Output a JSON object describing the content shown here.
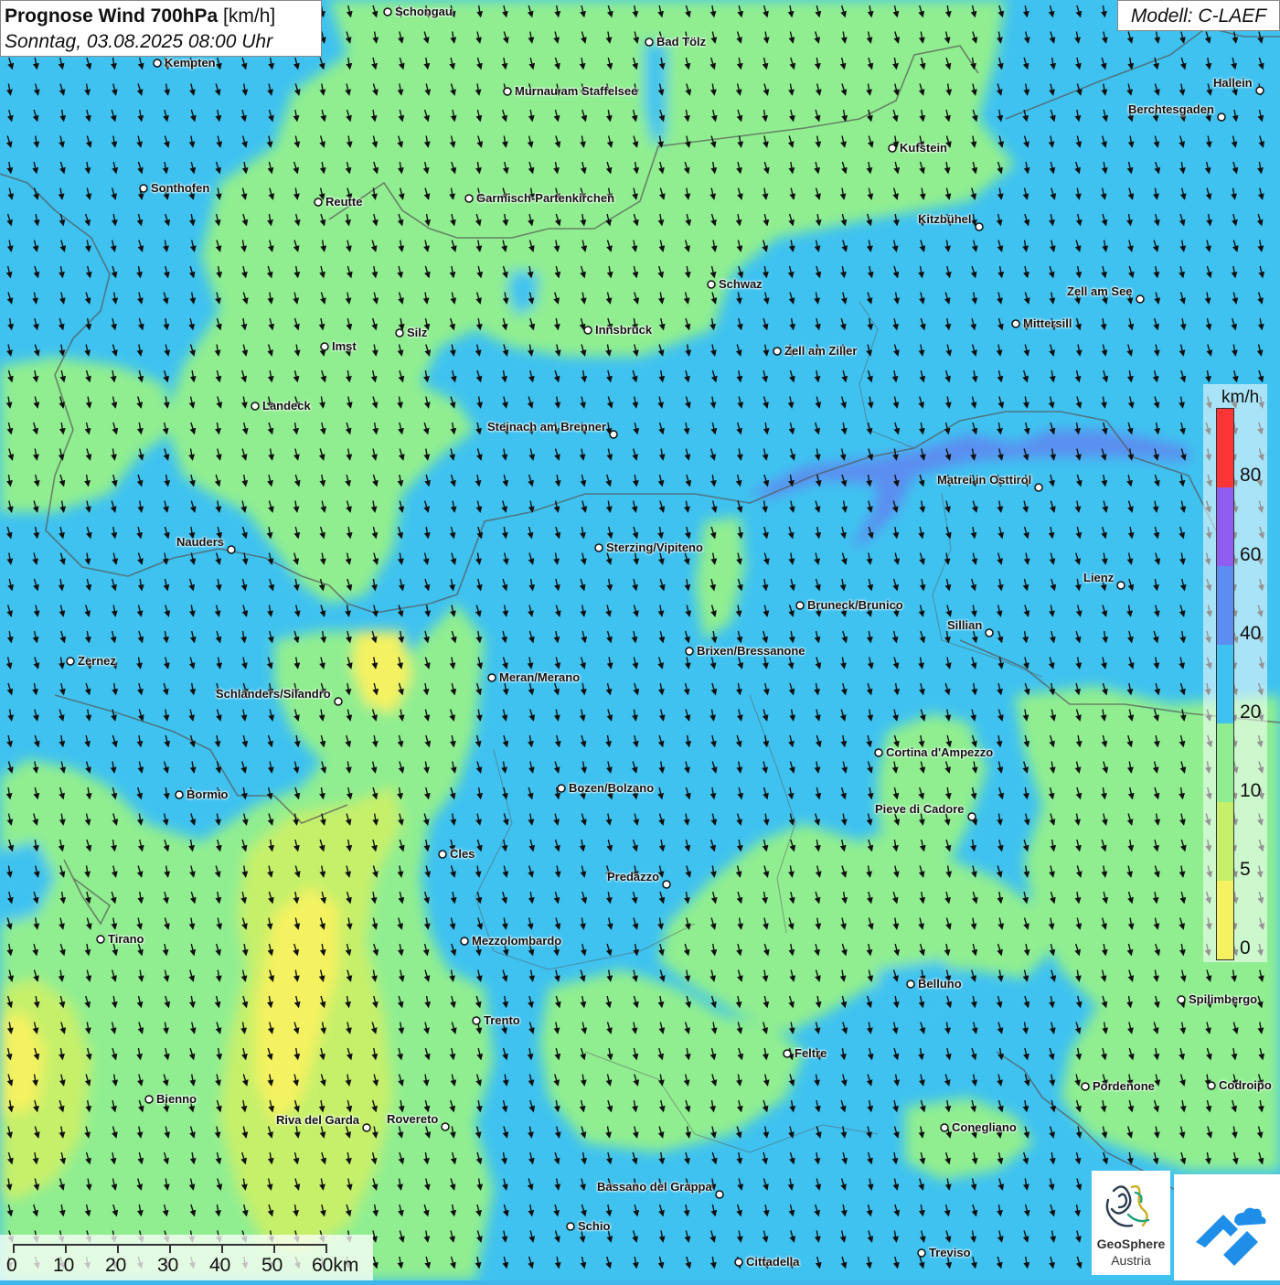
{
  "header": {
    "title_bold": "Prognose Wind 700hPa",
    "title_unit": "[km/h]",
    "subtitle": "Sonntag, 03.08.2025 08:00 Uhr",
    "model": "Modell: C-LAEF"
  },
  "legend": {
    "unit": "km/h",
    "labels": [
      "80",
      "60",
      "40",
      "20",
      "10",
      "5",
      "0"
    ],
    "colors": {
      "c0_5": "#f4f260",
      "c5_10": "#c6f06a",
      "c10_20": "#90ee90",
      "c20_40": "#3fc2f0",
      "c40_60": "#5b8ef0",
      "c60_80": "#8f5df0",
      "c80_plus": "#ff3535"
    }
  },
  "cities": [
    {
      "name": "Schongau"
    },
    {
      "name": "Bad Tölz"
    },
    {
      "name": "Kempten"
    },
    {
      "name": "Murnau am Staffelsee"
    },
    {
      "name": "Hallein"
    },
    {
      "name": "Berchtesgaden"
    },
    {
      "name": "Kufstein"
    },
    {
      "name": "Sonthofen"
    },
    {
      "name": "Reutte"
    },
    {
      "name": "Garmisch-Partenkirchen"
    },
    {
      "name": "Kitzbühel"
    },
    {
      "name": "Schwaz"
    },
    {
      "name": "Zell am See"
    },
    {
      "name": "Mittersill"
    },
    {
      "name": "Innsbruck"
    },
    {
      "name": "Silz"
    },
    {
      "name": "Imst"
    },
    {
      "name": "Zell am Ziller"
    },
    {
      "name": "Landeck"
    },
    {
      "name": "Steinach am Brenner"
    },
    {
      "name": "Matrei in Osttirol"
    },
    {
      "name": "Nauders"
    },
    {
      "name": "Sterzing/Vipiteno"
    },
    {
      "name": "Lienz"
    },
    {
      "name": "Bruneck/Brunico"
    },
    {
      "name": "Sillian"
    },
    {
      "name": "Brixen/Bressanone"
    },
    {
      "name": "Zernez"
    },
    {
      "name": "Meran/Merano"
    },
    {
      "name": "Schlanders/Silandro"
    },
    {
      "name": "Cortina d'Ampezzo"
    },
    {
      "name": "Bozen/Bolzano"
    },
    {
      "name": "Bormio"
    },
    {
      "name": "Pieve di Cadore"
    },
    {
      "name": "Cles"
    },
    {
      "name": "Predazzo"
    },
    {
      "name": "Tirano"
    },
    {
      "name": "Mezzolombardo"
    },
    {
      "name": "Belluno"
    },
    {
      "name": "Spilimbergo"
    },
    {
      "name": "Trento"
    },
    {
      "name": "Feltre"
    },
    {
      "name": "Pordenone"
    },
    {
      "name": "Codroipo"
    },
    {
      "name": "Bienno"
    },
    {
      "name": "Riva del Garda"
    },
    {
      "name": "Rovereto"
    },
    {
      "name": "Conegliano"
    },
    {
      "name": "Bassano del Grappa"
    },
    {
      "name": "Schio"
    },
    {
      "name": "Cittadella"
    },
    {
      "name": "Treviso"
    }
  ],
  "scale": {
    "labels": [
      "0",
      "10",
      "20",
      "30",
      "40",
      "50",
      "60km"
    ]
  },
  "logos": {
    "geosphere_line1": "GeoSphere",
    "geosphere_line2": "Austria"
  }
}
